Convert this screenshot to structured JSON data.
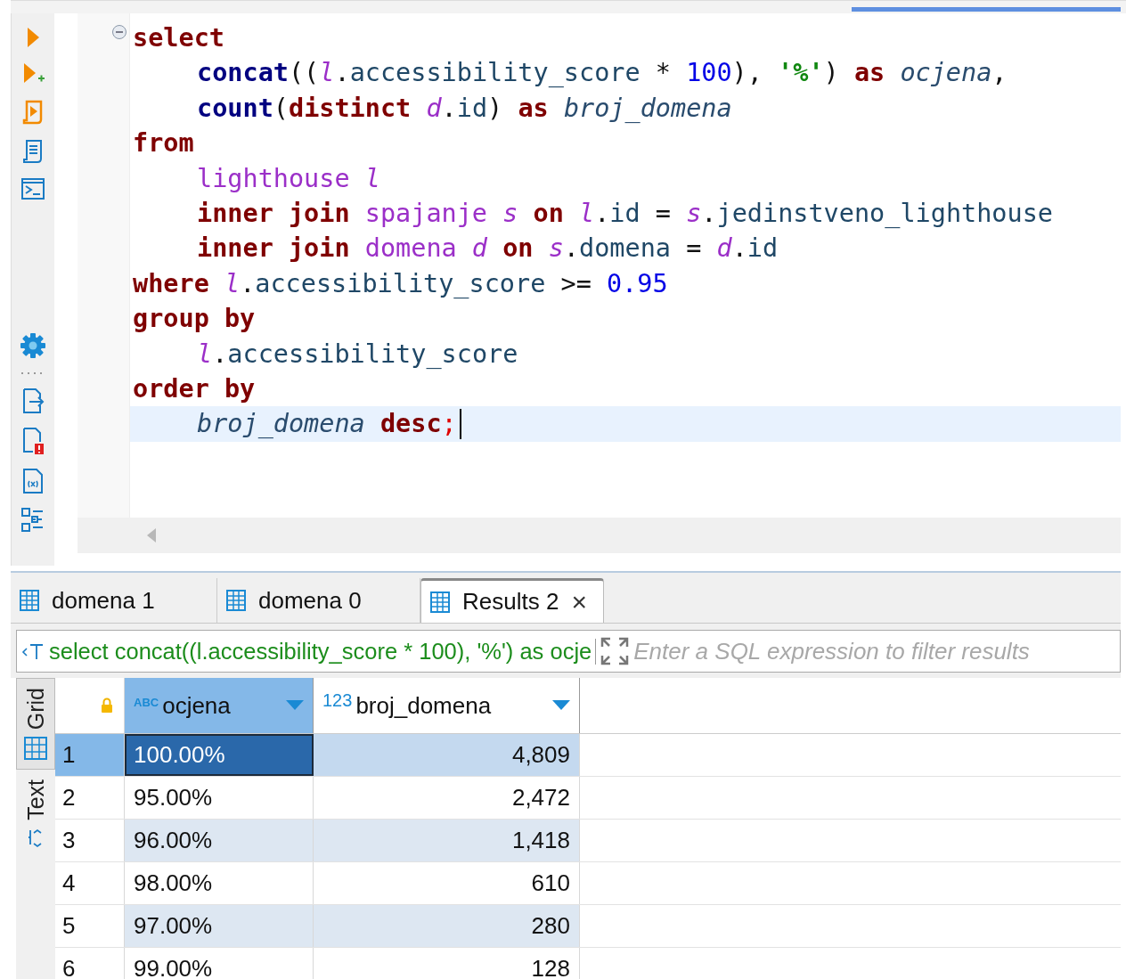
{
  "editor": {
    "lines": [
      {
        "indented": false,
        "fold": true,
        "current": false,
        "tokens": [
          {
            "kind": "kw",
            "t": "select"
          }
        ]
      },
      {
        "indented": true,
        "fold": false,
        "current": false,
        "tokens": [
          {
            "kind": "fn",
            "t": "concat"
          },
          {
            "kind": "op",
            "t": "(("
          },
          {
            "kind": "alias",
            "t": "l"
          },
          {
            "kind": "op",
            "t": "."
          },
          {
            "kind": "col",
            "t": "accessibility_score",
            "space_after": true
          },
          {
            "kind": "op",
            "t": "*",
            "space_after": true
          },
          {
            "kind": "num",
            "t": "100"
          },
          {
            "kind": "op",
            "t": "),",
            "space_after": true
          },
          {
            "kind": "str",
            "t": "'%'"
          },
          {
            "kind": "op",
            "t": ")",
            "space_after": true
          },
          {
            "kind": "kw",
            "t": "as",
            "space_after": true
          },
          {
            "kind": "calias",
            "t": "ocjena"
          },
          {
            "kind": "op",
            "t": ","
          }
        ]
      },
      {
        "indented": true,
        "fold": false,
        "current": false,
        "tokens": [
          {
            "kind": "fn",
            "t": "count"
          },
          {
            "kind": "op",
            "t": "("
          },
          {
            "kind": "kw",
            "t": "distinct",
            "space_after": true
          },
          {
            "kind": "alias",
            "t": "d"
          },
          {
            "kind": "op",
            "t": "."
          },
          {
            "kind": "col",
            "t": "id"
          },
          {
            "kind": "op",
            "t": ")",
            "space_after": true
          },
          {
            "kind": "kw",
            "t": "as",
            "space_after": true
          },
          {
            "kind": "calias",
            "t": "broj_domena"
          }
        ]
      },
      {
        "indented": false,
        "fold": false,
        "current": false,
        "tokens": [
          {
            "kind": "kw",
            "t": "from"
          }
        ]
      },
      {
        "indented": true,
        "fold": false,
        "current": false,
        "tokens": [
          {
            "kind": "table",
            "t": "lighthouse",
            "space_after": true
          },
          {
            "kind": "alias",
            "t": "l"
          }
        ]
      },
      {
        "indented": true,
        "fold": false,
        "current": false,
        "tokens": [
          {
            "kind": "kw",
            "t": "inner join",
            "space_after": true
          },
          {
            "kind": "table",
            "t": "spajanje",
            "space_after": true
          },
          {
            "kind": "alias",
            "t": "s",
            "space_after": true
          },
          {
            "kind": "kw",
            "t": "on",
            "space_after": true
          },
          {
            "kind": "alias",
            "t": "l"
          },
          {
            "kind": "op",
            "t": "."
          },
          {
            "kind": "col",
            "t": "id",
            "space_after": true
          },
          {
            "kind": "op",
            "t": "=",
            "space_after": true
          },
          {
            "kind": "alias",
            "t": "s"
          },
          {
            "kind": "op",
            "t": "."
          },
          {
            "kind": "col",
            "t": "jedinstveno_lighthouse"
          }
        ]
      },
      {
        "indented": true,
        "fold": false,
        "current": false,
        "tokens": [
          {
            "kind": "kw",
            "t": "inner join",
            "space_after": true
          },
          {
            "kind": "table",
            "t": "domena",
            "space_after": true
          },
          {
            "kind": "alias",
            "t": "d",
            "space_after": true
          },
          {
            "kind": "kw",
            "t": "on",
            "space_after": true
          },
          {
            "kind": "alias",
            "t": "s"
          },
          {
            "kind": "op",
            "t": "."
          },
          {
            "kind": "col",
            "t": "domena",
            "space_after": true
          },
          {
            "kind": "op",
            "t": "=",
            "space_after": true
          },
          {
            "kind": "alias",
            "t": "d"
          },
          {
            "kind": "op",
            "t": "."
          },
          {
            "kind": "col",
            "t": "id"
          }
        ]
      },
      {
        "indented": false,
        "fold": false,
        "current": false,
        "tokens": [
          {
            "kind": "kw",
            "t": "where",
            "space_after": true
          },
          {
            "kind": "alias",
            "t": "l"
          },
          {
            "kind": "op",
            "t": "."
          },
          {
            "kind": "col",
            "t": "accessibility_score",
            "space_after": true
          },
          {
            "kind": "op",
            "t": ">=",
            "space_after": true
          },
          {
            "kind": "num",
            "t": "0.95"
          }
        ]
      },
      {
        "indented": false,
        "fold": false,
        "current": false,
        "tokens": [
          {
            "kind": "kw",
            "t": "group by"
          }
        ]
      },
      {
        "indented": true,
        "fold": false,
        "current": false,
        "tokens": [
          {
            "kind": "alias",
            "t": "l"
          },
          {
            "kind": "op",
            "t": "."
          },
          {
            "kind": "col",
            "t": "accessibility_score"
          }
        ]
      },
      {
        "indented": false,
        "fold": false,
        "current": false,
        "tokens": [
          {
            "kind": "kw",
            "t": "order by"
          }
        ]
      },
      {
        "indented": true,
        "fold": false,
        "current": true,
        "tokens": [
          {
            "kind": "calias",
            "t": "broj_domena",
            "space_after": true
          },
          {
            "kind": "kw",
            "t": "desc"
          },
          {
            "kind": "semi",
            "t": ";"
          }
        ]
      }
    ]
  },
  "result_tabs": [
    {
      "label": "domena 1",
      "selected": false,
      "closable": false
    },
    {
      "label": "domena 0",
      "selected": false,
      "closable": false
    },
    {
      "label": "Results 2",
      "selected": true,
      "closable": true,
      "close_label": "×"
    }
  ],
  "filter": {
    "query": "select concat((l.accessibility_score * 100), '%') as ocje",
    "placeholder": "Enter a SQL expression to filter results"
  },
  "view_tabs": [
    {
      "label": "Grid",
      "selected": true
    },
    {
      "label": "Text",
      "selected": false
    }
  ],
  "grid": {
    "columns": [
      {
        "type_label": "ABC",
        "name": "ocjena",
        "kind": "string",
        "selected": true
      },
      {
        "type_label": "123",
        "name": "broj_domena",
        "kind": "number",
        "selected": false
      }
    ],
    "rows": [
      {
        "number": "1",
        "selected": true,
        "cells": [
          "100.00%",
          "4,809"
        ]
      },
      {
        "number": "2",
        "selected": false,
        "cells": [
          "95.00%",
          "2,472"
        ]
      },
      {
        "number": "3",
        "selected": false,
        "cells": [
          "96.00%",
          "1,418"
        ]
      },
      {
        "number": "4",
        "selected": false,
        "cells": [
          "98.00%",
          "610"
        ]
      },
      {
        "number": "5",
        "selected": false,
        "cells": [
          "97.00%",
          "280"
        ]
      },
      {
        "number": "6",
        "selected": false,
        "cells": [
          "99.00%",
          "128"
        ]
      }
    ]
  }
}
